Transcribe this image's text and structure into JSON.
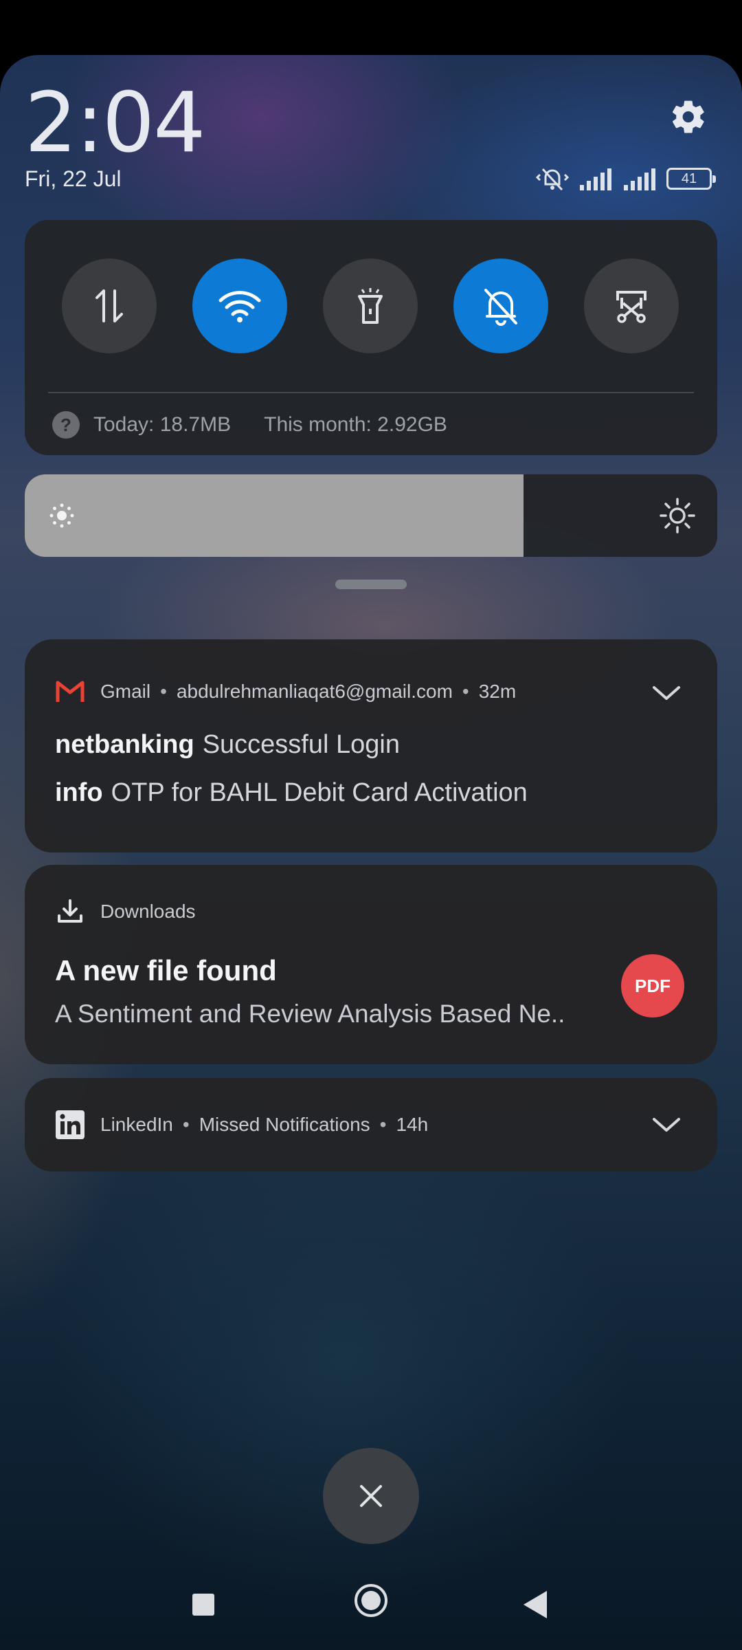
{
  "status": {
    "time": "2:04",
    "date": "Fri, 22 Jul",
    "battery": "41",
    "icons": [
      "mute-vibrate-icon",
      "signal-1-icon",
      "signal-2-icon",
      "battery-icon"
    ]
  },
  "quick_settings": {
    "tiles": [
      {
        "name": "mobile-data",
        "icon": "data-transfer-icon",
        "active": false
      },
      {
        "name": "wifi",
        "icon": "wifi-icon",
        "active": true
      },
      {
        "name": "flashlight",
        "icon": "flashlight-icon",
        "active": false
      },
      {
        "name": "silent",
        "icon": "bell-off-icon",
        "active": true
      },
      {
        "name": "screenshot",
        "icon": "scissors-screenshot-icon",
        "active": false
      }
    ],
    "usage_today": "Today: 18.7MB",
    "usage_month": "This month: 2.92GB"
  },
  "brightness": {
    "level_percent": 72
  },
  "notifications": {
    "gmail": {
      "app": "Gmail",
      "account": "abdulrehmanliaqat6@gmail.com",
      "time": "32m",
      "lines": [
        {
          "sender": "netbanking",
          "subject": "Successful Login"
        },
        {
          "sender": "info",
          "subject": "OTP for BAHL Debit Card Activation"
        }
      ]
    },
    "downloads": {
      "app": "Downloads",
      "title": "A new file found",
      "subtitle": "A Sentiment and Review Analysis Based Ne..",
      "badge": "PDF"
    },
    "linkedin": {
      "app": "LinkedIn",
      "summary": "Missed Notifications",
      "time": "14h"
    }
  },
  "colors": {
    "accent": "#0d7ad6",
    "pdf_badge": "#e5484d",
    "gmail_red": "#ea4335"
  }
}
